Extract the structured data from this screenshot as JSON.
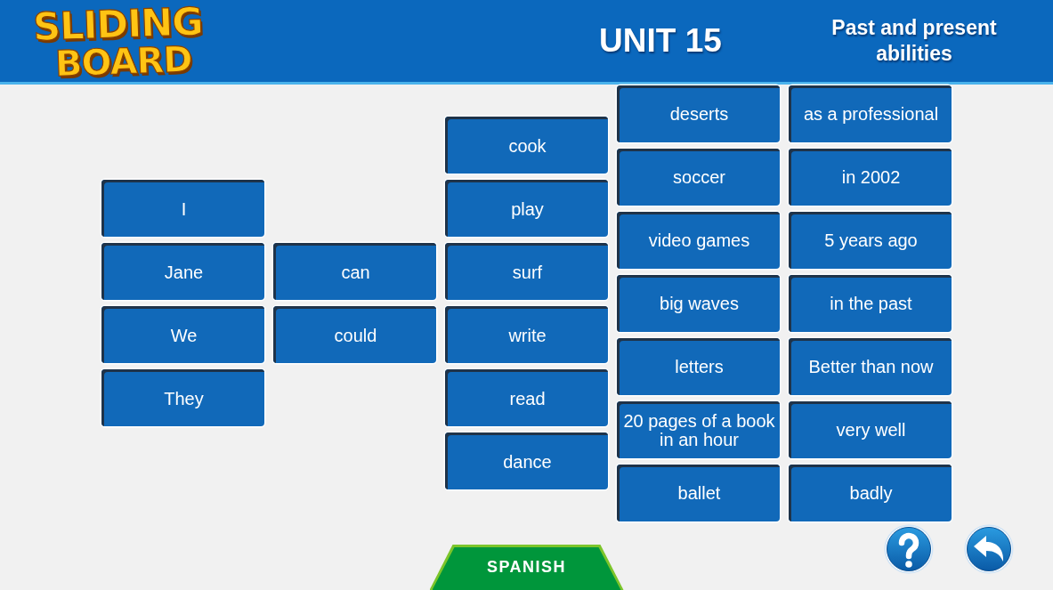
{
  "header": {
    "logo": [
      "SLIDING",
      "BOARD"
    ],
    "unit": "UNIT 15",
    "topic": "Past and present abilities"
  },
  "columns": [
    {
      "tiles": [
        "I",
        "Jane",
        "We",
        "They"
      ]
    },
    {
      "tiles": [
        "can",
        "could"
      ]
    },
    {
      "tiles": [
        "cook",
        "play",
        "surf",
        "write",
        "read",
        "dance"
      ]
    },
    {
      "tiles": [
        "deserts",
        "soccer",
        "video games",
        "big waves",
        "letters",
        "20 pages of a book in an hour",
        "ballet"
      ]
    },
    {
      "tiles": [
        "as a professional",
        "in 2002",
        "5 years ago",
        "in the past",
        "Better than now",
        "very well",
        "badly"
      ]
    }
  ],
  "language_tab": {
    "label": "SPANISH"
  },
  "buttons": [
    {
      "kind": "help"
    },
    {
      "kind": "back"
    }
  ]
}
